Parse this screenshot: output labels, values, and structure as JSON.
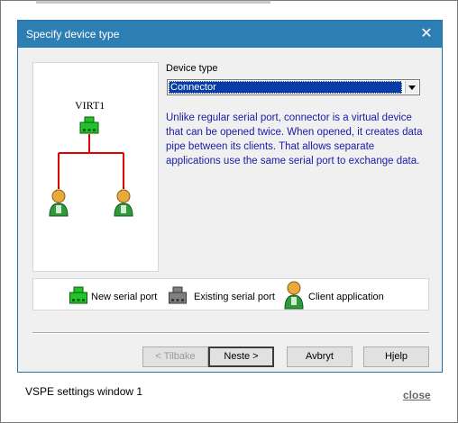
{
  "dialog": {
    "title": "Specify device type",
    "close_glyph": "✕",
    "preview": {
      "device_name": "VIRT1"
    },
    "device_type": {
      "label": "Device type",
      "selected": "Connector"
    },
    "description": "Unlike regular serial port, connector is a virtual device that can be opened twice. When opened, it creates data pipe between its clients. That allows separate applications use the same serial port to exchange data.",
    "legend": {
      "new_port": "New serial port",
      "existing_port": "Existing serial port",
      "client_app": "Client application"
    },
    "buttons": {
      "back": "< Tilbake",
      "next": "Neste >",
      "cancel": "Avbryt",
      "help": "Hjelp"
    }
  },
  "footer": {
    "caption": "VSPE settings window 1",
    "close_label": "close"
  },
  "colors": {
    "titlebar": "#2d7fb3",
    "new_port": "#22c22a",
    "existing_port": "#808080",
    "connector_line": "#e00000",
    "description_text": "#1b1ba6",
    "selection": "#0a3ca8"
  },
  "icons": {
    "new_port": "green-serial-port-icon",
    "existing_port": "gray-serial-port-icon",
    "client": "person-client-icon",
    "close": "close-icon",
    "dropdown": "chevron-down-icon"
  }
}
